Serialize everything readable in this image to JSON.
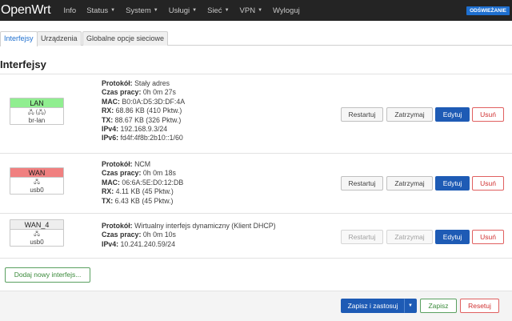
{
  "header": {
    "brand": "OpenWrt",
    "menu": [
      {
        "label": "Info",
        "has_caret": false
      },
      {
        "label": "Status",
        "has_caret": true
      },
      {
        "label": "System",
        "has_caret": true
      },
      {
        "label": "Usługi",
        "has_caret": true
      },
      {
        "label": "Sieć",
        "has_caret": true
      },
      {
        "label": "VPN",
        "has_caret": true
      },
      {
        "label": "Wyloguj",
        "has_caret": false
      }
    ],
    "refresh_label": "ODŚWIEŻANIE"
  },
  "tabs": [
    {
      "label": "Interfejsy",
      "active": true
    },
    {
      "label": "Urządzenia",
      "active": false
    },
    {
      "label": "Globalne opcje sieciowe",
      "active": false
    }
  ],
  "section_title": "Interfejsy",
  "interfaces": [
    {
      "name": "LAN",
      "color": "#90ee90",
      "icons": "🖧 (🖧)",
      "device": "br-lan",
      "info": [
        {
          "label": "Protokół:",
          "value": "Stały adres"
        },
        {
          "label": "Czas pracy:",
          "value": "0h 0m 27s"
        },
        {
          "label": "MAC:",
          "value": "B0:0A:D5:3D:DF:4A"
        },
        {
          "label": "RX:",
          "value": "68.86 KB (410 Pktw.)"
        },
        {
          "label": "TX:",
          "value": "88.67 KB (326 Pktw.)"
        },
        {
          "label": "IPv4:",
          "value": "192.168.9.3/24"
        },
        {
          "label": "IPv6:",
          "value": "fd4f:4f8b:2b10::1/60"
        }
      ],
      "restart_disabled": false,
      "stop_disabled": false
    },
    {
      "name": "WAN",
      "color": "#f08080",
      "icons": "🖧",
      "device": "usb0",
      "info": [
        {
          "label": "Protokół:",
          "value": "NCM"
        },
        {
          "label": "Czas pracy:",
          "value": "0h 0m 18s"
        },
        {
          "label": "MAC:",
          "value": "06:6A:5E:D0:12:DB"
        },
        {
          "label": "RX:",
          "value": "4.11 KB (45 Pktw.)"
        },
        {
          "label": "TX:",
          "value": "6.43 KB (45 Pktw.)"
        }
      ],
      "restart_disabled": false,
      "stop_disabled": false
    },
    {
      "name": "WAN_4",
      "color": "#eeeeee",
      "icons": "🖧",
      "device": "usb0",
      "info": [
        {
          "label": "Protokół:",
          "value": "Wirtualny interfejs dynamiczny (Klient DHCP)"
        },
        {
          "label": "Czas pracy:",
          "value": "0h 0m 10s"
        },
        {
          "label": "IPv4:",
          "value": "10.241.240.59/24"
        }
      ],
      "restart_disabled": true,
      "stop_disabled": true
    }
  ],
  "row_buttons": {
    "restart": "Restartuj",
    "stop": "Zatrzymaj",
    "edit": "Edytuj",
    "delete": "Usuń"
  },
  "add_interface_label": "Dodaj nowy interfejs...",
  "footer": {
    "save_apply": "Zapisz i zastosuj",
    "save": "Zapisz",
    "reset": "Resetuj"
  }
}
